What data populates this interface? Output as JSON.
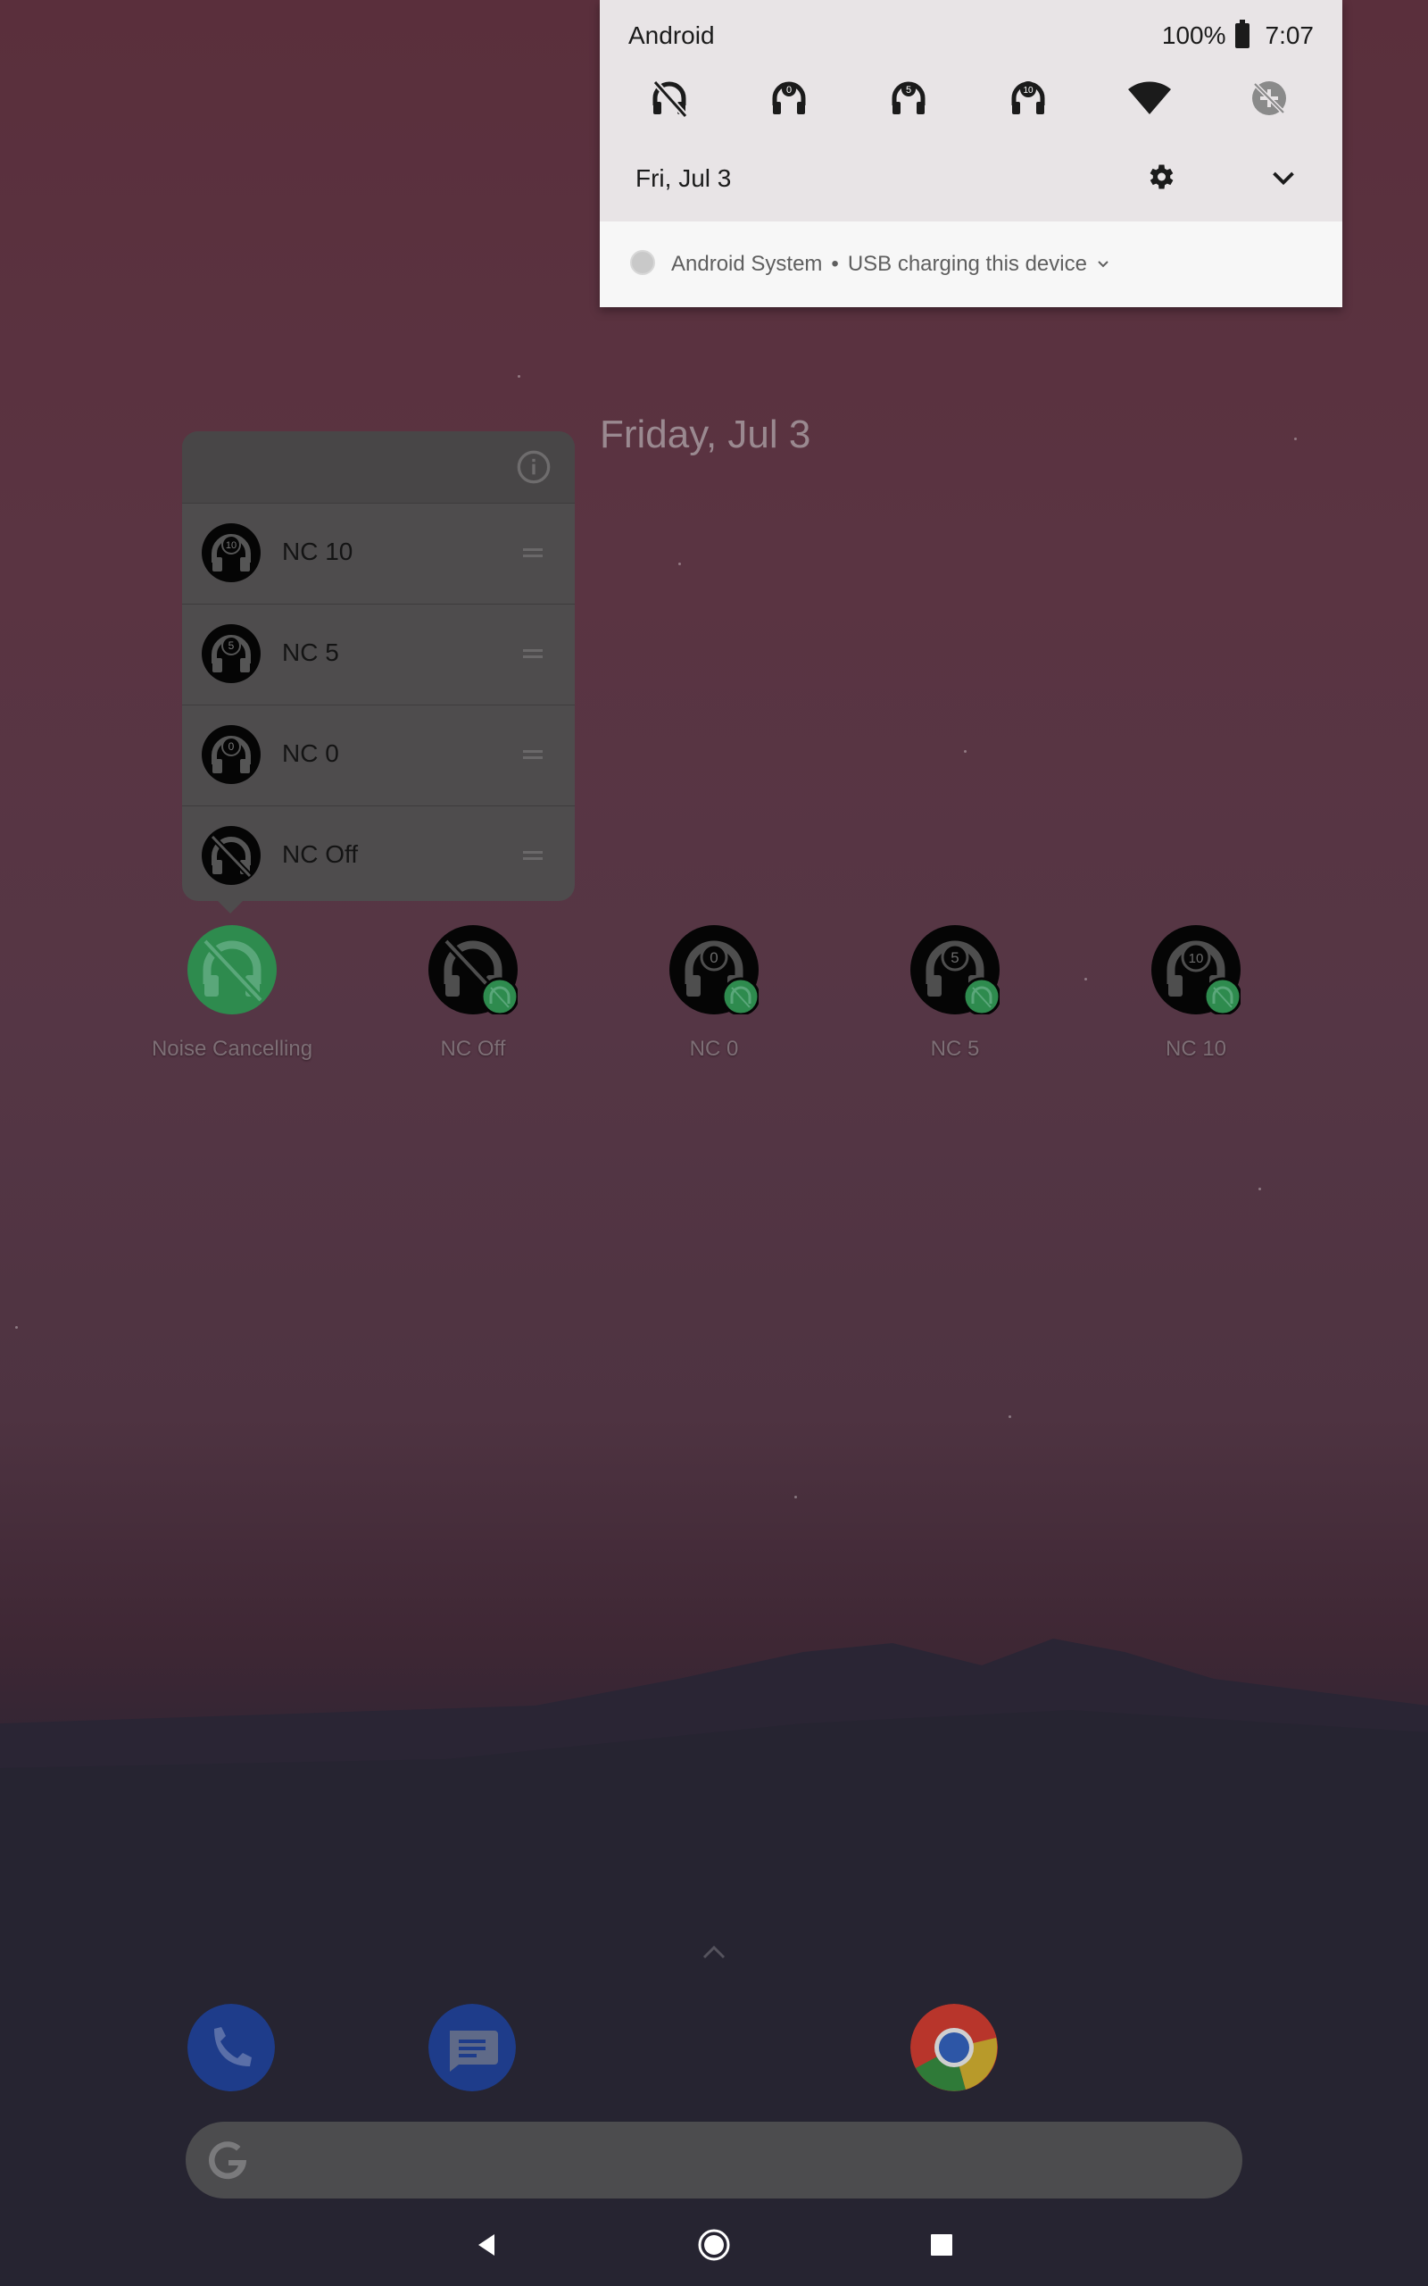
{
  "status_bar": {
    "carrier": "Android",
    "battery": "100%",
    "time": "7:07"
  },
  "quick_settings": {
    "tiles": [
      {
        "name": "nc-off",
        "badge": ""
      },
      {
        "name": "nc-0",
        "badge": "0"
      },
      {
        "name": "nc-5",
        "badge": "5"
      },
      {
        "name": "nc-10",
        "badge": "10"
      },
      {
        "name": "wifi",
        "badge": ""
      },
      {
        "name": "data-saver",
        "badge": ""
      }
    ],
    "date": "Fri, Jul 3"
  },
  "notification": {
    "app": "Android System",
    "separator": "•",
    "text": "USB charging this device"
  },
  "home": {
    "date": "Friday, Jul 3"
  },
  "popup": {
    "items": [
      {
        "label": "NC 10",
        "badge": "10"
      },
      {
        "label": "NC 5",
        "badge": "5"
      },
      {
        "label": "NC 0",
        "badge": "0"
      },
      {
        "label": "NC Off",
        "badge": ""
      }
    ]
  },
  "shortcuts": [
    {
      "label": "Noise Cancelling",
      "badge": "",
      "style": "green"
    },
    {
      "label": "NC Off",
      "badge": "",
      "style": "off"
    },
    {
      "label": "NC 0",
      "badge": "0",
      "style": "num"
    },
    {
      "label": "NC 5",
      "badge": "5",
      "style": "num"
    },
    {
      "label": "NC 10",
      "badge": "10",
      "style": "num"
    }
  ],
  "colors": {
    "accent_green": "#2e8b4e",
    "popup_bg": "#4e4c4d",
    "shade_bg": "#e8e4e6"
  }
}
